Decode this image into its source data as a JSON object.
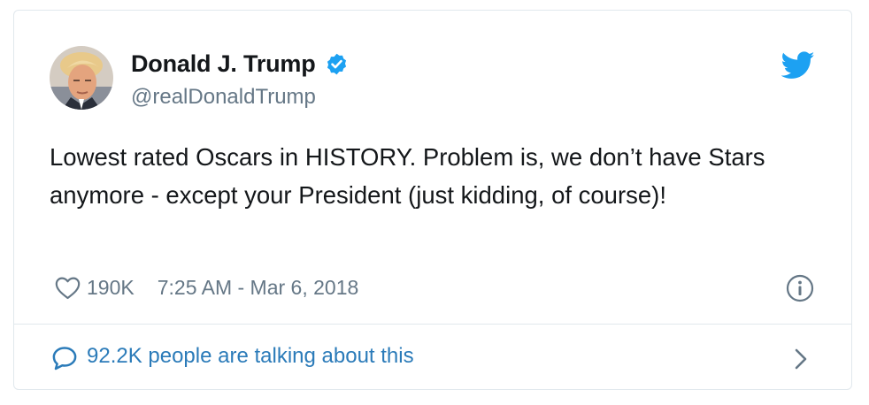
{
  "tweet": {
    "author": {
      "display_name": "Donald J. Trump",
      "handle": "@realDonaldTrump",
      "verified": true
    },
    "text": "Lowest rated Oscars in HISTORY. Problem is, we don’t have Stars anymore - except your President (just kidding, of course)!",
    "likes": "190K",
    "timestamp": "7:25 AM - Mar 6, 2018",
    "conversation": "92.2K people are talking about this"
  },
  "icons": {
    "brand": "twitter-bird-icon",
    "verified": "verified-badge-icon",
    "like": "heart-icon",
    "info": "info-icon",
    "reply": "speech-bubble-icon",
    "more": "chevron-right-icon"
  },
  "colors": {
    "brand_blue": "#1da1f2",
    "link_blue": "#2b7bb9",
    "text": "#14171a",
    "muted": "#657786",
    "border": "#e1e8ed"
  }
}
